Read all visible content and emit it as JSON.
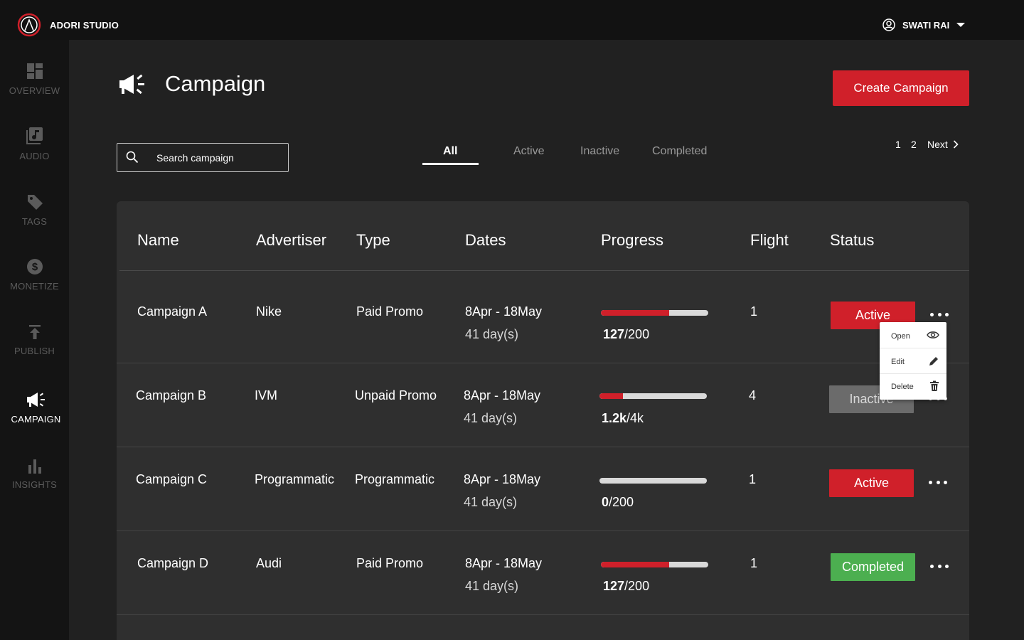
{
  "app": {
    "brand": "ADORI STUDIO",
    "user_name": "SWATI RAI"
  },
  "sidebar": {
    "items": [
      {
        "label": "OVERVIEW",
        "icon": "dashboard-icon",
        "active": false
      },
      {
        "label": "AUDIO",
        "icon": "music-library-icon",
        "active": false
      },
      {
        "label": "TAGS",
        "icon": "tag-icon",
        "active": false
      },
      {
        "label": "MONETIZE",
        "icon": "dollar-icon",
        "active": false
      },
      {
        "label": "PUBLISH",
        "icon": "publish-icon",
        "active": false
      },
      {
        "label": "CAMPAIGN",
        "icon": "megaphone-icon",
        "active": true
      },
      {
        "label": "INSIGHTS",
        "icon": "bar-chart-icon",
        "active": false
      }
    ]
  },
  "header": {
    "title": "Campaign",
    "create_label": "Create Campaign"
  },
  "search": {
    "placeholder": "Search campaign",
    "value": ""
  },
  "tabs": [
    {
      "label": "All",
      "active": true
    },
    {
      "label": "Active",
      "active": false
    },
    {
      "label": "Inactive",
      "active": false
    },
    {
      "label": "Completed",
      "active": false
    }
  ],
  "pagination": {
    "pages": [
      "1",
      "2"
    ],
    "next_label": "Next"
  },
  "table": {
    "columns": [
      "Name",
      "Advertiser",
      "Type",
      "Dates",
      "Progress",
      "Flight",
      "Status"
    ],
    "rows": [
      {
        "name": "Campaign A",
        "advertiser": "Nike",
        "type": "Paid Promo",
        "dates": "8Apr - 18May",
        "duration": "41 day(s)",
        "progress_done": "127",
        "progress_total": "/200",
        "progress_fraction": 0.635,
        "flight": "1",
        "status": "Active",
        "status_kind": "active"
      },
      {
        "name": "Campaign B",
        "advertiser": "IVM",
        "type": "Unpaid Promo",
        "dates": "8Apr - 18May",
        "duration": "41 day(s)",
        "progress_done": "1.2k",
        "progress_total": "/4k",
        "progress_fraction": 0.22,
        "flight": "4",
        "status": "Inactive",
        "status_kind": "inactive"
      },
      {
        "name": "Campaign C",
        "advertiser": "Programmatic",
        "type": "Programmatic",
        "dates": "8Apr - 18May",
        "duration": "41 day(s)",
        "progress_done": "0",
        "progress_total": "/200",
        "progress_fraction": 0.0,
        "flight": "1",
        "status": "Active",
        "status_kind": "active"
      },
      {
        "name": "Campaign D",
        "advertiser": "Audi",
        "type": "Paid Promo",
        "dates": "8Apr - 18May",
        "duration": "41 day(s)",
        "progress_done": "127",
        "progress_total": "/200",
        "progress_fraction": 0.635,
        "flight": "1",
        "status": "Completed",
        "status_kind": "completed"
      }
    ]
  },
  "context_menu": {
    "items": [
      {
        "label": "Open",
        "icon": "eye-icon"
      },
      {
        "label": "Edit",
        "icon": "pencil-icon"
      },
      {
        "label": "Delete",
        "icon": "trash-icon"
      }
    ]
  },
  "colors": {
    "accent": "#d0202a",
    "completed": "#4caf50",
    "inactive": "#6b6b6b",
    "sidebar_bg": "#141414",
    "page_bg": "#212121",
    "table_bg": "#2f2f2f"
  }
}
